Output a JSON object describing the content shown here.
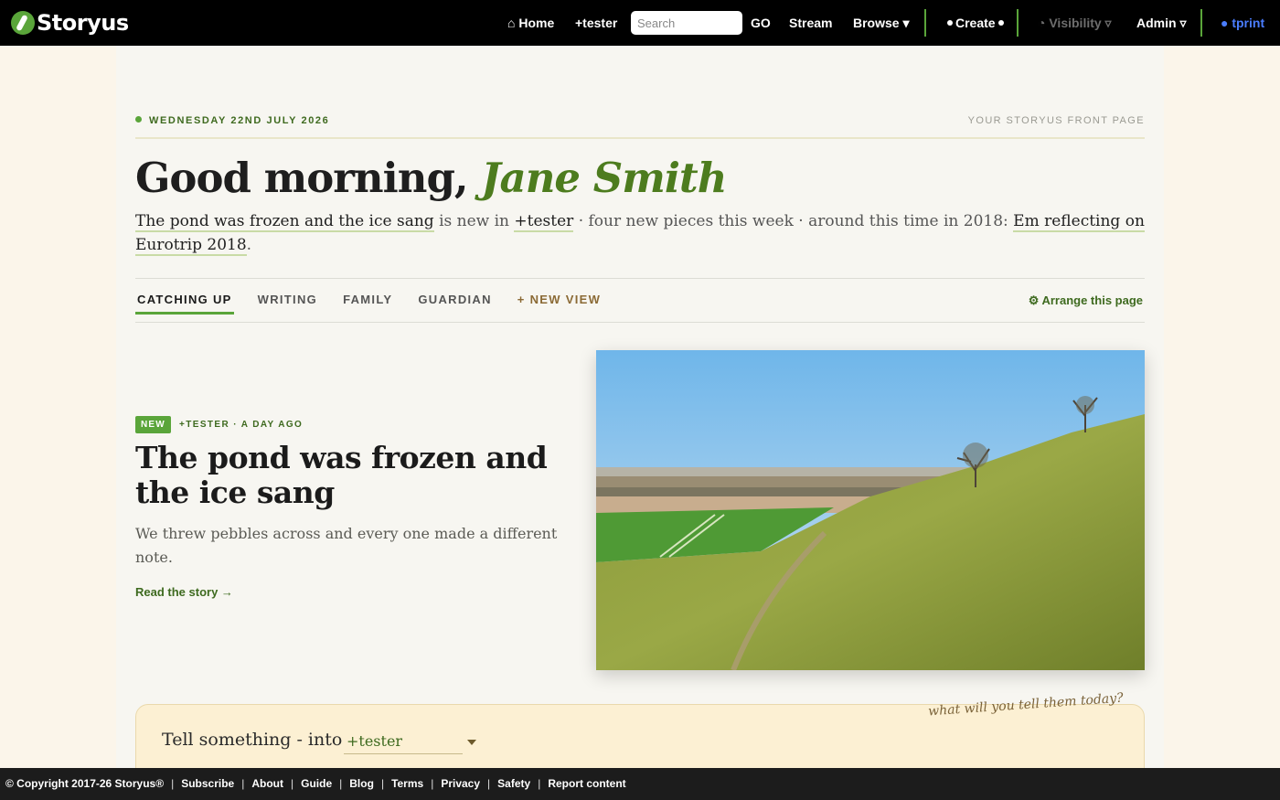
{
  "nav": {
    "logo_text": "Storyus",
    "home": "⌂ Home",
    "tester": "+tester",
    "search_placeholder": "Search",
    "go": "GO",
    "stream": "Stream",
    "browse": "Browse ▾",
    "create": "Create",
    "visibility": "◔ Visibility ▿",
    "admin": "Admin ▿",
    "tprint": "● tprint"
  },
  "header": {
    "date": "WEDNESDAY 22ND JULY 2026",
    "front_page_label": "YOUR STORYUS FRONT PAGE",
    "greeting": "Good morning,",
    "user_name": "Jane Smith"
  },
  "summary": {
    "story_link": "The pond was frozen and the ice sang",
    "is_new_in": " is new in ",
    "group_link": "+tester",
    "middle": " · four new pieces this week · around this time in 2018: ",
    "memory_link": "Em reflecting on Eurotrip 2018",
    "end": "."
  },
  "tabs": {
    "items": [
      "CATCHING UP",
      "WRITING",
      "FAMILY",
      "GUARDIAN"
    ],
    "new_view": "+ NEW VIEW",
    "arrange": "⚙ Arrange this page"
  },
  "feature": {
    "badge": "NEW",
    "meta": "+TESTER · A DAY AGO",
    "title": "The pond was frozen and the ice sang",
    "excerpt": "We threw pebbles across and every one made a different note.",
    "read_link": "Read the story →"
  },
  "tell": {
    "label": "Tell something - into",
    "selected_group": "+tester",
    "hint": "what will you tell them today?"
  },
  "footer": {
    "copyright": "© Copyright 2017-26 Storyus®",
    "links": [
      "Subscribe",
      "About",
      "Guide",
      "Blog",
      "Terms",
      "Privacy",
      "Safety",
      "Report content"
    ]
  },
  "colors": {
    "brand_green": "#5aa53a",
    "dark_green": "#3e6a1f",
    "nav_bg": "#000000",
    "accent_blue": "#4a7dff"
  }
}
